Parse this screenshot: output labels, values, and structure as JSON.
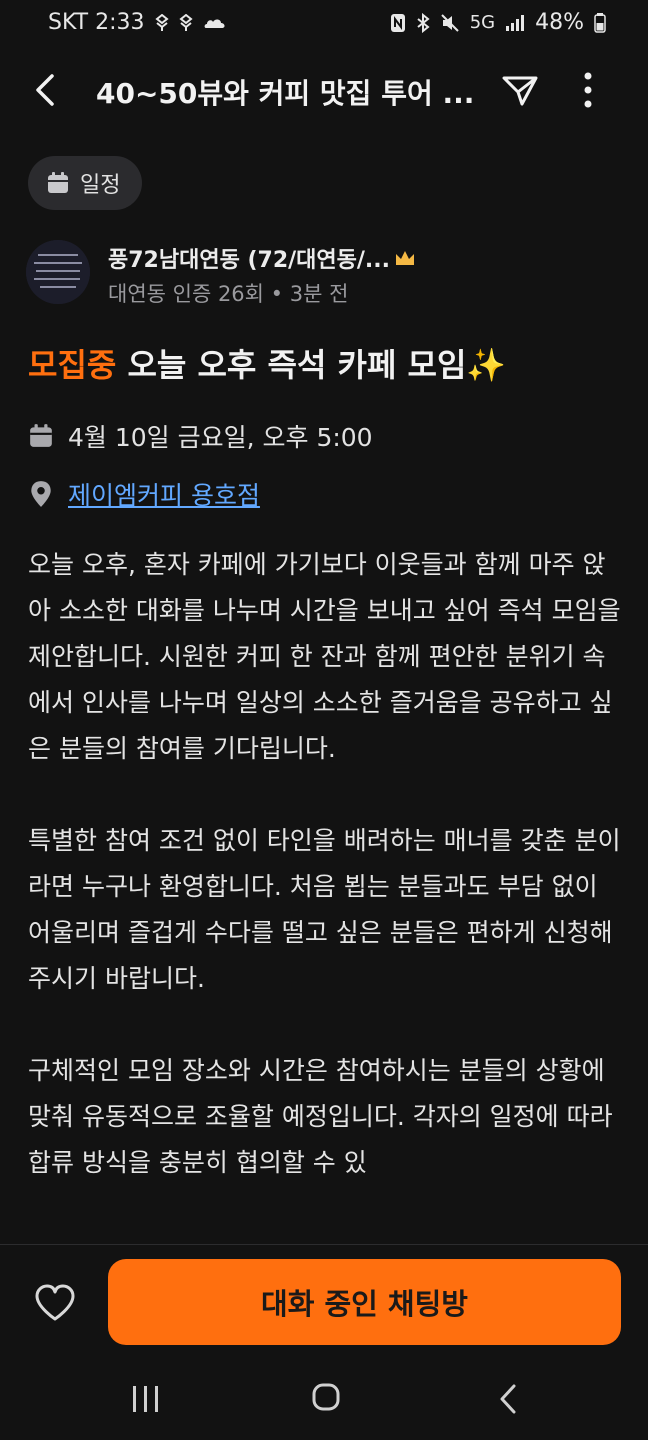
{
  "status_bar": {
    "carrier_time": "SKT 2:33",
    "left_icons": [
      "dropbox-icon",
      "dropbox-icon",
      "cloud-icon"
    ],
    "right_icons": [
      "nfc-icon",
      "bluetooth-icon",
      "mute-icon",
      "5g-icon",
      "signal-icon"
    ],
    "network": "5G",
    "battery": "48%"
  },
  "header": {
    "title": "40~50뷰와 커피 맛집 투어 ...",
    "back_icon": "chevron-left-icon",
    "share_icon": "send-icon",
    "more_icon": "more-vertical-icon"
  },
  "category": {
    "label": "일정",
    "icon": "calendar-icon"
  },
  "author": {
    "name": "풍72남대연동 (72/대연동/...",
    "badge_icon": "crown-icon",
    "meta": "대연동 인증 26회 • 3분 전"
  },
  "post": {
    "status": "모집중",
    "title": "오늘 오후 즉석 카페 모임✨",
    "date": "4월 10일 금요일, 오후 5:00",
    "place": "제이엠커피 용호점",
    "body": [
      "오늘 오후, 혼자 카페에 가기보다 이웃들과 함께 마주 앉아 소소한 대화를 나누며 시간을 보내고 싶어 즉석 모임을 제안합니다. 시원한 커피 한 잔과 함께 편안한 분위기 속에서 인사를 나누며 일상의 소소한 즐거움을 공유하고 싶은 분들의 참여를 기다립니다.",
      "특별한 참여 조건 없이 타인을 배려하는 매너를 갖춘 분이라면 누구나 환영합니다. 처음 뵙는 분들과도 부담 없이 어울리며 즐겁게 수다를 떨고 싶은 분들은 편하게 신청해 주시기 바랍니다.",
      "구체적인 모임 장소와 시간은 참여하시는 분들의 상황에 맞춰 유동적으로 조율할 예정입니다. 각자의 일정에 따라 합류 방식을 충분히 협의할 수 있"
    ]
  },
  "actions": {
    "like_icon": "heart-icon",
    "chat_button": "대화 중인 채팅방"
  },
  "nav": {
    "recents_icon": "recents-icon",
    "home_icon": "home-icon",
    "back_icon": "back-icon"
  },
  "colors": {
    "accent": "#ff6f0f",
    "link": "#62a8ff",
    "background": "#121212",
    "chip": "#2b2b2e"
  }
}
